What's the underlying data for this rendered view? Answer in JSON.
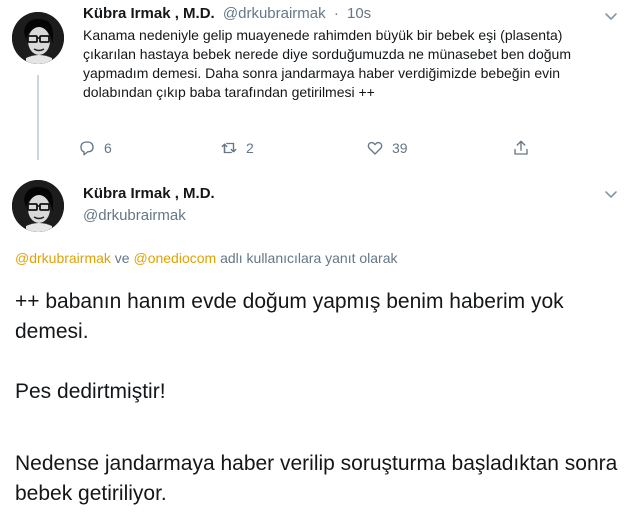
{
  "tweet1": {
    "display_name": "Kübra Irmak , M.D.",
    "handle": "@drkubrairmak",
    "separator": "·",
    "time": "10s",
    "text": "Kanama nedeniyle gelip muayenede rahimden büyük bir bebek eşi (plasenta) çıkarılan hastaya bebek nerede diye sorduğumuzda ne münasebet ben doğum yapmadım demesi. Daha sonra jandarmaya haber verdiğimizde bebeğin evin dolabından çıkıp baba tarafından getirilmesi ++",
    "replies": "6",
    "retweets": "2",
    "likes": "39",
    "icons": {
      "reply": "reply-icon",
      "retweet": "retweet-icon",
      "like": "heart-icon",
      "share": "share-icon",
      "more": "chevron-down-icon"
    }
  },
  "tweet2": {
    "display_name": "Kübra Irmak , M.D.",
    "handle": "@drkubrairmak",
    "replying_to": {
      "mention1": "@drkubrairmak",
      "connector": "ve",
      "mention2": "@onediocom",
      "suffix": "adlı kullanıcılara yanıt olarak"
    },
    "paragraphs": [
      "++ babanın hanım evde doğum yapmış benim haberim yok demesi.",
      "Pes dedirtmiştir!",
      "Nedense jandarmaya haber verilip soruşturma başladıktan sonra bebek getiriliyor."
    ]
  },
  "colors": {
    "text": "#14171a",
    "secondary": "#657786",
    "mention": "#e0a300",
    "thread_line": "#ccd6dd"
  }
}
